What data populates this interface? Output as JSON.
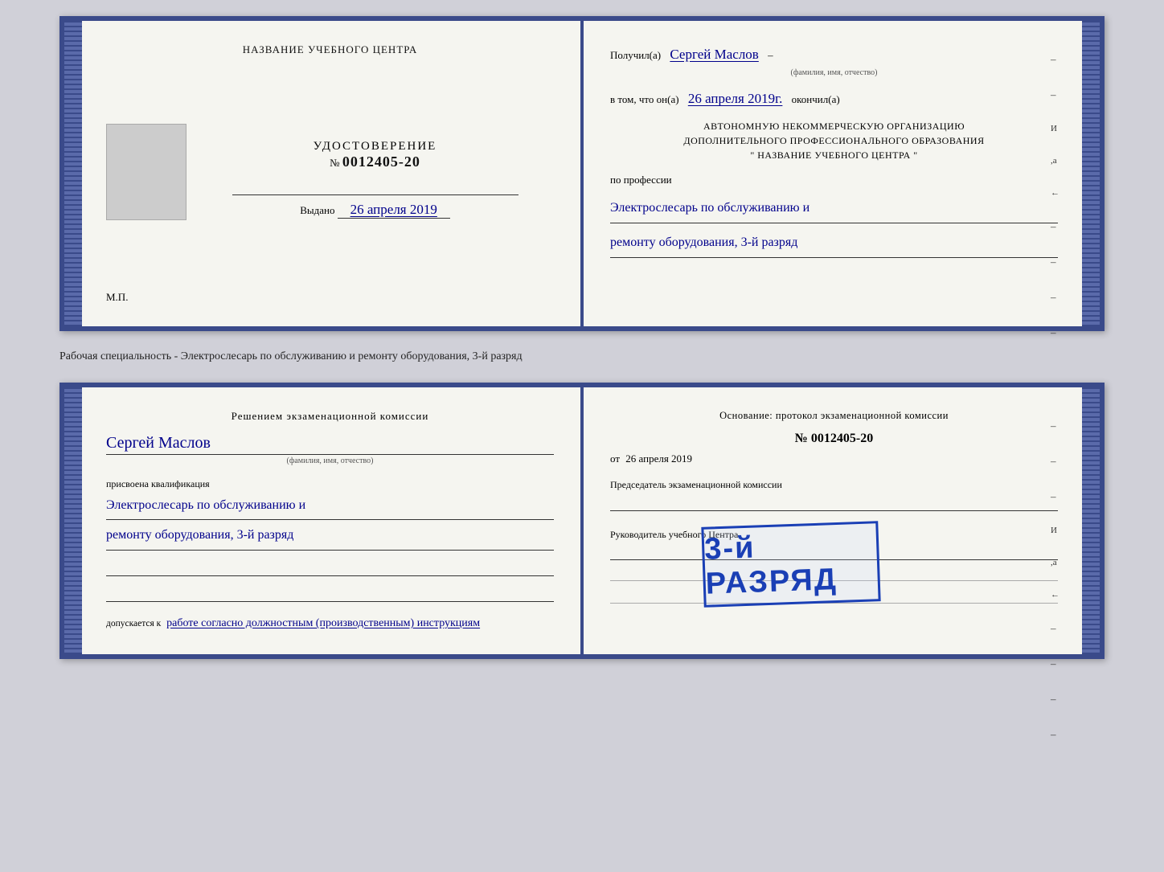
{
  "top_cert": {
    "left": {
      "org_name": "НАЗВАНИЕ УЧЕБНОГО ЦЕНТРА",
      "cert_label": "УДОСТОВЕРЕНИЕ",
      "cert_number_prefix": "№",
      "cert_number": "0012405-20",
      "issued_label": "Выдано",
      "issued_date": "26 апреля 2019",
      "mp_label": "М.П."
    },
    "right": {
      "received_label": "Получил(а)",
      "received_name": "Сергей Маслов",
      "received_name_sub": "(фамилия, имя, отчество)",
      "dash1": "–",
      "in_that_label": "в том, что он(а)",
      "date_hw": "26 апреля 2019г.",
      "finished_label": "окончил(а)",
      "org_block_line1": "АВТОНОМНУЮ НЕКОММЕРЧЕСКУЮ ОРГАНИЗАЦИЮ",
      "org_block_line2": "ДОПОЛНИТЕЛЬНОГО ПРОФЕССИОНАЛЬНОГО ОБРАЗОВАНИЯ",
      "org_block_quote": "\"  НАЗВАНИЕ УЧЕБНОГО ЦЕНТРА  \"",
      "profession_label": "по профессии",
      "profession_hw_line1": "Электрослесарь по обслуживанию и",
      "profession_hw_line2": "ремонту оборудования, 3-й разряд"
    }
  },
  "between_text": "Рабочая специальность - Электрослесарь по обслуживанию и ремонту оборудования, 3-й разряд",
  "bottom_cert": {
    "left": {
      "decision_title": "Решением экзаменационной  комиссии",
      "name_hw": "Сергей Маслов",
      "name_sub": "(фамилия, имя, отчество)",
      "assigned_label": "присвоена квалификация",
      "qualification_hw_line1": "Электрослесарь по обслуживанию и",
      "qualification_hw_line2": "ремонту оборудования, 3-й разряд",
      "admission_static": "допускается к",
      "admission_hw": "работе согласно должностным (производственным) инструкциям"
    },
    "right": {
      "basis_label": "Основание: протокол экзаменационной  комиссии",
      "protocol_number_prefix": "№",
      "protocol_number": "0012405-20",
      "date_label": "от",
      "date_value": "26 апреля 2019",
      "president_label": "Председатель экзаменационной комиссии",
      "leader_label": "Руководитель учебного Центра"
    },
    "stamp": {
      "text": "3-й РАЗРЯД"
    }
  }
}
